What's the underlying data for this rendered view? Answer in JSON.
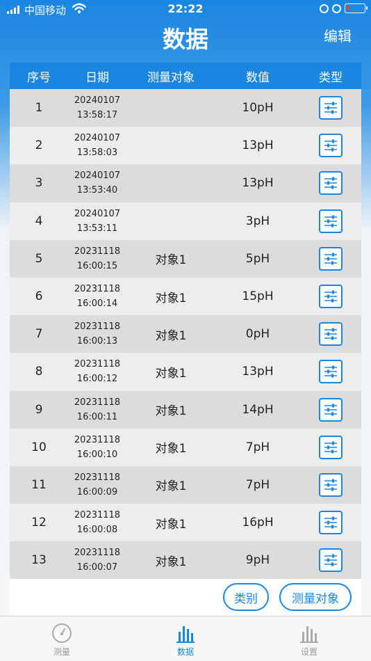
{
  "status_bar": {
    "carrier": "中国移动",
    "time": "22:22"
  },
  "nav": {
    "title": "数据",
    "edit_label": "编辑"
  },
  "table": {
    "headers": [
      "序号",
      "日期",
      "测量对象",
      "数值",
      "类型"
    ],
    "rows": [
      {
        "index": "1",
        "date": "20240107",
        "time": "13:58:17",
        "object": "",
        "value": "10pH"
      },
      {
        "index": "2",
        "date": "20240107",
        "time": "13:58:03",
        "object": "",
        "value": "13pH"
      },
      {
        "index": "3",
        "date": "20240107",
        "time": "13:53:40",
        "object": "",
        "value": "13pH"
      },
      {
        "index": "4",
        "date": "20240107",
        "time": "13:53:11",
        "object": "",
        "value": "3pH"
      },
      {
        "index": "5",
        "date": "20231118",
        "time": "16:00:15",
        "object": "对象1",
        "value": "5pH"
      },
      {
        "index": "6",
        "date": "20231118",
        "time": "16:00:14",
        "object": "对象1",
        "value": "15pH"
      },
      {
        "index": "7",
        "date": "20231118",
        "time": "16:00:13",
        "object": "对象1",
        "value": "0pH"
      },
      {
        "index": "8",
        "date": "20231118",
        "time": "16:00:12",
        "object": "对象1",
        "value": "13pH"
      },
      {
        "index": "9",
        "date": "20231118",
        "time": "16:00:11",
        "object": "对象1",
        "value": "14pH"
      },
      {
        "index": "10",
        "date": "20231118",
        "time": "16:00:10",
        "object": "对象1",
        "value": "7pH"
      },
      {
        "index": "11",
        "date": "20231118",
        "time": "16:00:09",
        "object": "对象1",
        "value": "7pH"
      },
      {
        "index": "12",
        "date": "20231118",
        "time": "16:00:08",
        "object": "对象1",
        "value": "16pH"
      },
      {
        "index": "13",
        "date": "20231118",
        "time": "16:00:07",
        "object": "对象1",
        "value": "9pH"
      }
    ],
    "type_icon": "sliders-icon"
  },
  "footer": {
    "category_label": "类别",
    "object_label": "测量对象"
  },
  "tabbar": {
    "items": [
      {
        "label": "测量",
        "icon": "gauge-icon",
        "active": false
      },
      {
        "label": "数据",
        "icon": "bar-chart-icon",
        "active": true
      },
      {
        "label": "设置",
        "icon": "bar-chart-icon",
        "active": false
      }
    ]
  },
  "colors": {
    "accent": "#1a86e0",
    "row_dark": "#dcdcdc",
    "row_light": "#ededed"
  }
}
